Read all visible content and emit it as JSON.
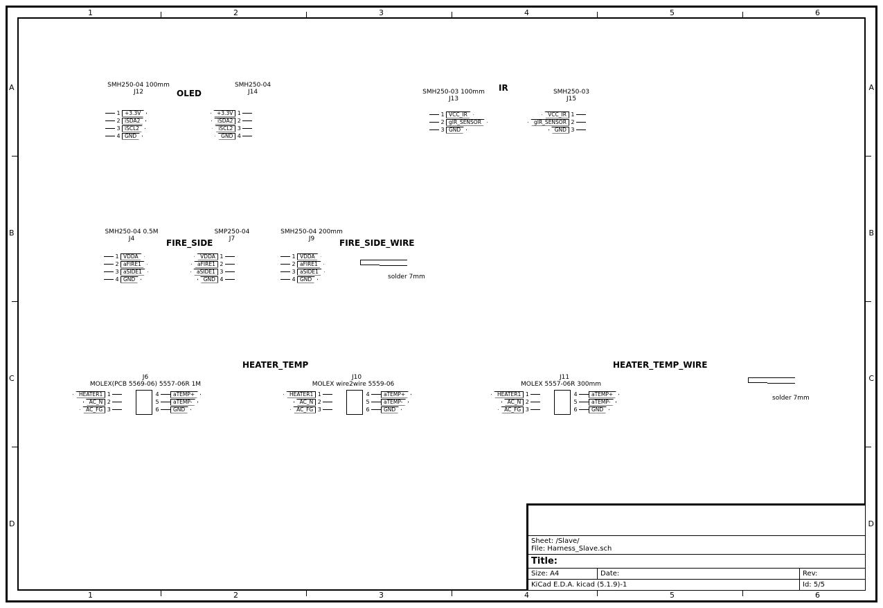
{
  "frame": {
    "columns": [
      "1",
      "2",
      "3",
      "4",
      "5",
      "6"
    ],
    "rows": [
      "A",
      "B",
      "C",
      "D"
    ]
  },
  "sections": {
    "oled": "OLED",
    "ir": "IR",
    "fire_side": "FIRE_SIDE",
    "fire_side_wire": "FIRE_SIDE_WIRE",
    "heater_temp": "HEATER_TEMP",
    "heater_temp_wire": "HEATER_TEMP_WIRE"
  },
  "components": {
    "J12": {
      "type": "SMH250-04 100mm",
      "ref": "J12",
      "pins_right": [
        "+3.3V",
        "iSDA2",
        "iSCL2",
        "GND"
      ]
    },
    "J14": {
      "type": "SMH250-04",
      "ref": "J14",
      "pins_left": [
        "+3.3V",
        "iSDA2",
        "iSCL2",
        "GND"
      ]
    },
    "J13": {
      "type": "SMH250-03 100mm",
      "ref": "J13",
      "pins_right": [
        "VCC_IR",
        "gIR_SENSOR",
        "GND"
      ]
    },
    "J15": {
      "type": "SMH250-03",
      "ref": "J15",
      "pins_left": [
        "VCC_IR",
        "gIR_SENSOR",
        "GND"
      ]
    },
    "J4": {
      "type": "SMH250-04 0.5M",
      "ref": "J4",
      "pins_right": [
        "VDDA",
        "aFIRE1",
        "aSIDE1",
        "GND"
      ]
    },
    "J7": {
      "type": "SMP250-04",
      "ref": "J7",
      "pins_left": [
        "VDDA",
        "aFIRE1",
        "aSIDE1",
        "GND"
      ]
    },
    "J9": {
      "type": "SMH250-04 200mm",
      "ref": "J9",
      "pins_right": [
        "VDDA",
        "aFIRE1",
        "aSIDE1",
        "GND"
      ]
    },
    "J6": {
      "type": "MOLEX(PCB 5569-06) 5557-06R 1M",
      "ref": "J6",
      "pins_left": [
        "HEATER1",
        "AC_N",
        "AC_FG"
      ],
      "pins_right": [
        "aTEMP+",
        "aTEMP-",
        "GND"
      ],
      "nums_left": [
        "1",
        "2",
        "3"
      ],
      "nums_right": [
        "4",
        "5",
        "6"
      ]
    },
    "J10": {
      "type": "MOLEX wire2wire 5559-06",
      "ref": "J10",
      "pins_left": [
        "HEATER1",
        "AC_N",
        "AC_FG"
      ],
      "pins_right": [
        "aTEMP+",
        "aTEMP-",
        "GND"
      ],
      "nums_left": [
        "1",
        "2",
        "3"
      ],
      "nums_right": [
        "4",
        "5",
        "6"
      ]
    },
    "J11": {
      "type": "MOLEX 5557-06R 300mm",
      "ref": "J11",
      "pins_left": [
        "HEATER1",
        "AC_N",
        "AC_FG"
      ],
      "pins_right": [
        "aTEMP+",
        "aTEMP-",
        "GND"
      ],
      "nums_left": [
        "1",
        "2",
        "3"
      ],
      "nums_right": [
        "4",
        "5",
        "6"
      ]
    }
  },
  "notes": {
    "solder1": "solder 7mm",
    "solder2": "solder 7mm"
  },
  "title_block": {
    "sheet_label": "Sheet:",
    "sheet": "/Slave/",
    "file_label": "File:",
    "file": "Harness_Slave.sch",
    "title_label": "Title:",
    "title": "",
    "size_label": "Size:",
    "size": "A4",
    "date_label": "Date:",
    "date": "",
    "rev_label": "Rev:",
    "rev": "",
    "tool": "KiCad E.D.A.  kicad (5.1.9)-1",
    "id_label": "Id:",
    "id": "5/5"
  }
}
